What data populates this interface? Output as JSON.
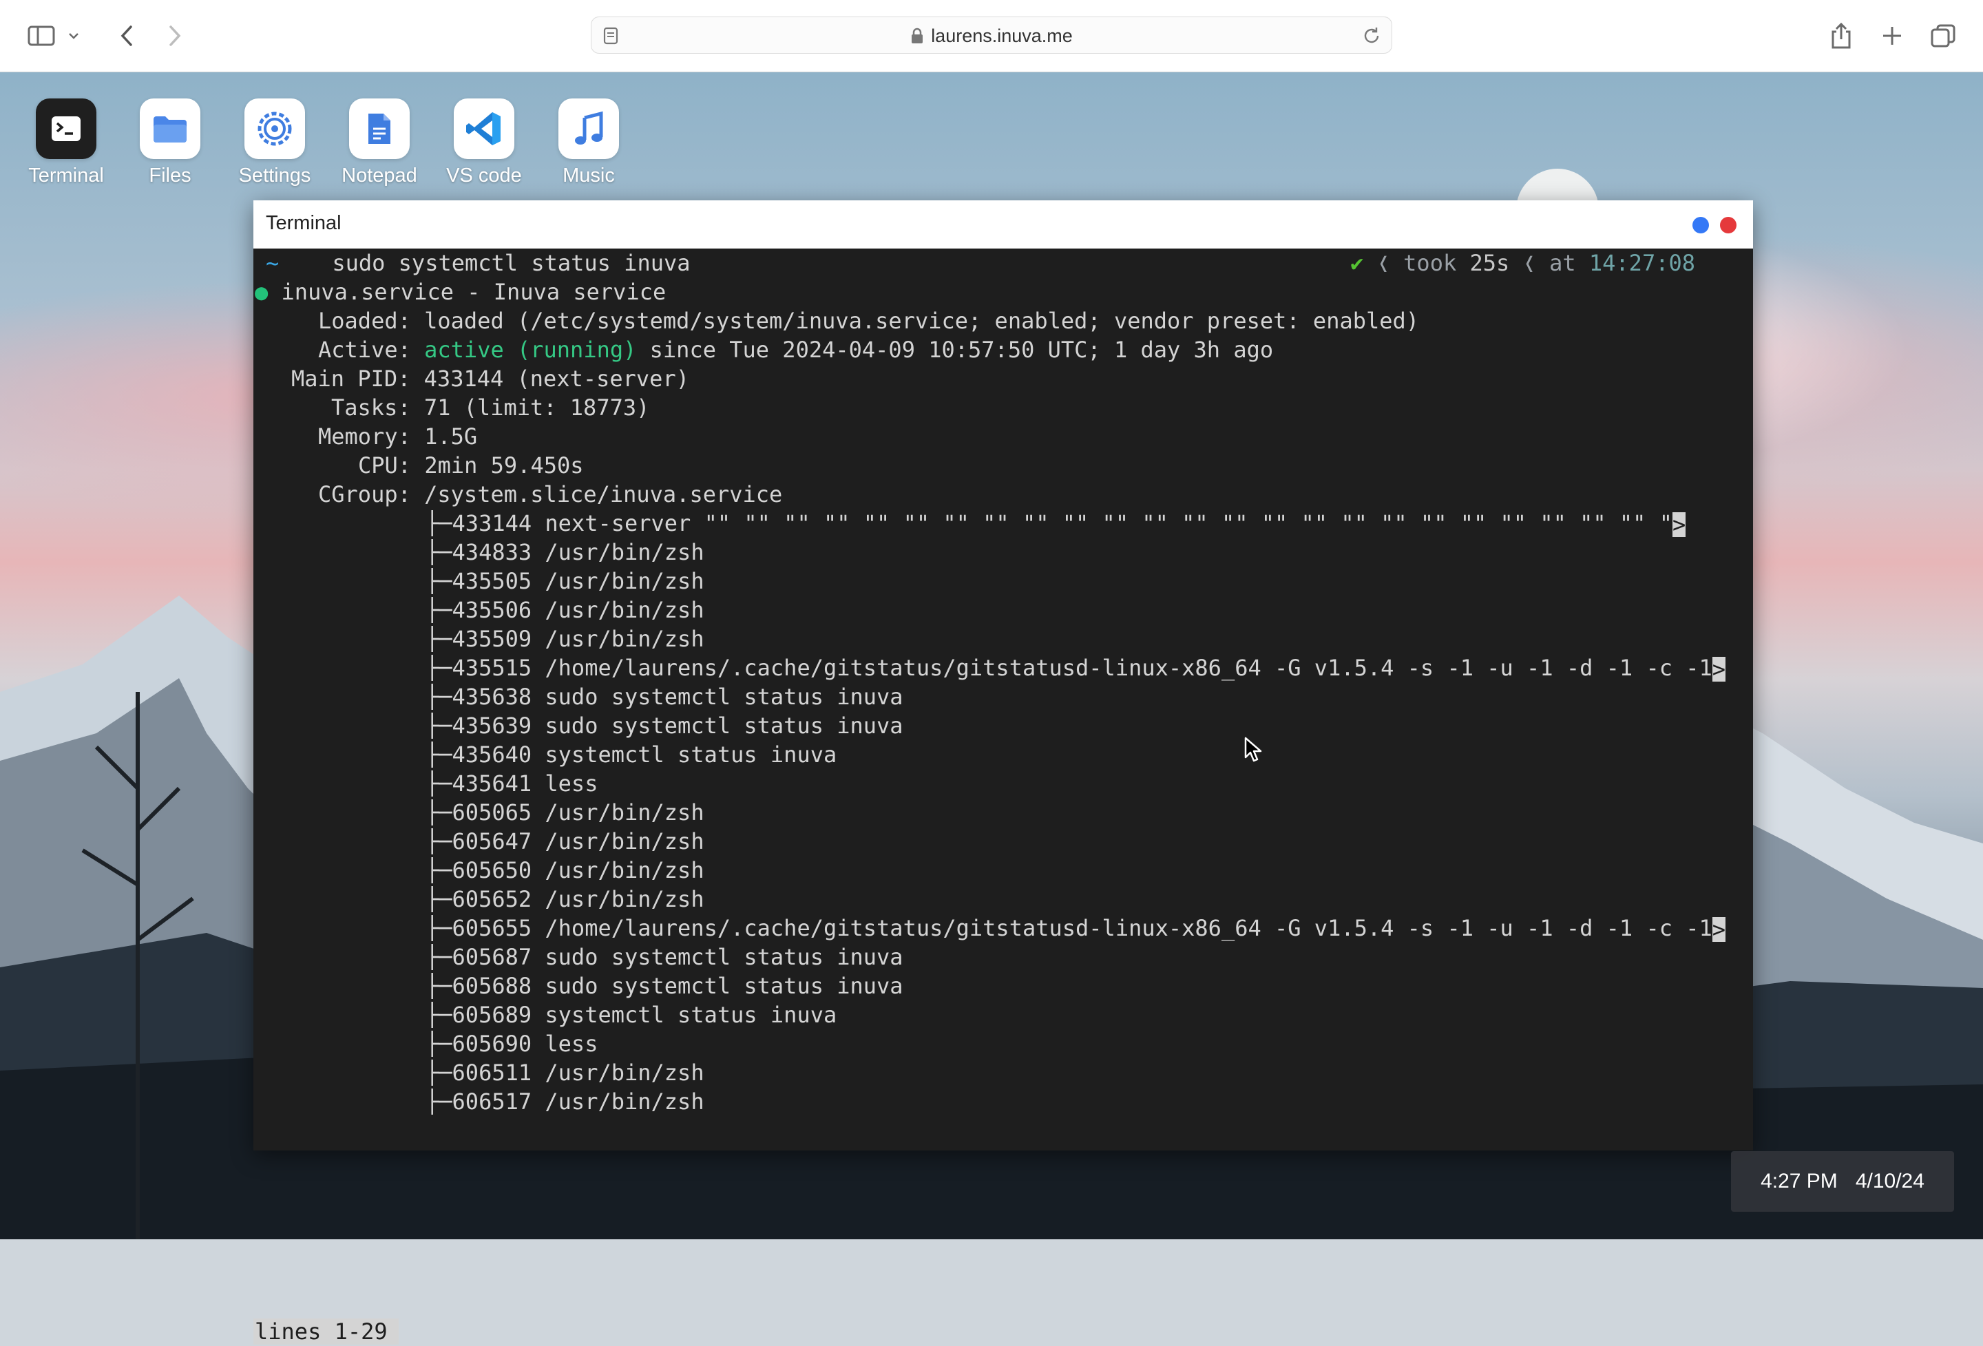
{
  "browser": {
    "url": "laurens.inuva.me"
  },
  "dock": [
    {
      "label": "Terminal",
      "icon": "terminal-icon"
    },
    {
      "label": "Files",
      "icon": "folder-icon"
    },
    {
      "label": "Settings",
      "icon": "gear-icon"
    },
    {
      "label": "Notepad",
      "icon": "document-icon"
    },
    {
      "label": "VS code",
      "icon": "vscode-icon"
    },
    {
      "label": "Music",
      "icon": "music-note-icon"
    }
  ],
  "terminal": {
    "title": "Terminal",
    "prompt": {
      "tilde": "~",
      "command": "sudo systemctl status inuva",
      "check": "✔",
      "took_label": "took",
      "took_value": "25s",
      "at_label": "at",
      "time": "14:27:08"
    },
    "service_header": {
      "dot": "●",
      "text": "inuva.service - Inuva service"
    },
    "status": {
      "loaded_label": "Loaded:",
      "loaded_value": "loaded (/etc/systemd/system/inuva.service; enabled; vendor preset: enabled)",
      "active_label": "Active:",
      "active_state": "active (running)",
      "active_since": "since Tue 2024-04-09 10:57:50 UTC; 1 day 3h ago",
      "mainpid_label": "Main PID:",
      "mainpid_value": "433144 (next-server)",
      "tasks_label": "Tasks:",
      "tasks_value": "71 (limit: 18773)",
      "memory_label": "Memory:",
      "memory_value": "1.5G",
      "cpu_label": "CPU:",
      "cpu_value": "2min 59.450s",
      "cgroup_label": "CGroup:",
      "cgroup_value": "/system.slice/inuva.service"
    },
    "processes": [
      {
        "tree": "├─",
        "pid": "433144",
        "cmd": "next-server \"\" \"\" \"\" \"\" \"\" \"\" \"\" \"\" \"\" \"\" \"\" \"\" \"\" \"\" \"\" \"\" \"\" \"\" \"\" \"\" \"\" \"\" \"\" \"\" \"",
        "truncated": true
      },
      {
        "tree": "├─",
        "pid": "434833",
        "cmd": "/usr/bin/zsh",
        "truncated": false
      },
      {
        "tree": "├─",
        "pid": "435505",
        "cmd": "/usr/bin/zsh",
        "truncated": false
      },
      {
        "tree": "├─",
        "pid": "435506",
        "cmd": "/usr/bin/zsh",
        "truncated": false
      },
      {
        "tree": "├─",
        "pid": "435509",
        "cmd": "/usr/bin/zsh",
        "truncated": false
      },
      {
        "tree": "├─",
        "pid": "435515",
        "cmd": "/home/laurens/.cache/gitstatus/gitstatusd-linux-x86_64 -G v1.5.4 -s -1 -u -1 -d -1 -c -1",
        "truncated": true
      },
      {
        "tree": "├─",
        "pid": "435638",
        "cmd": "sudo systemctl status inuva",
        "truncated": false
      },
      {
        "tree": "├─",
        "pid": "435639",
        "cmd": "sudo systemctl status inuva",
        "truncated": false
      },
      {
        "tree": "├─",
        "pid": "435640",
        "cmd": "systemctl status inuva",
        "truncated": false
      },
      {
        "tree": "├─",
        "pid": "435641",
        "cmd": "less",
        "truncated": false
      },
      {
        "tree": "├─",
        "pid": "605065",
        "cmd": "/usr/bin/zsh",
        "truncated": false
      },
      {
        "tree": "├─",
        "pid": "605647",
        "cmd": "/usr/bin/zsh",
        "truncated": false
      },
      {
        "tree": "├─",
        "pid": "605650",
        "cmd": "/usr/bin/zsh",
        "truncated": false
      },
      {
        "tree": "├─",
        "pid": "605652",
        "cmd": "/usr/bin/zsh",
        "truncated": false
      },
      {
        "tree": "├─",
        "pid": "605655",
        "cmd": "/home/laurens/.cache/gitstatus/gitstatusd-linux-x86_64 -G v1.5.4 -s -1 -u -1 -d -1 -c -1",
        "truncated": true
      },
      {
        "tree": "├─",
        "pid": "605687",
        "cmd": "sudo systemctl status inuva",
        "truncated": false
      },
      {
        "tree": "├─",
        "pid": "605688",
        "cmd": "sudo systemctl status inuva",
        "truncated": false
      },
      {
        "tree": "├─",
        "pid": "605689",
        "cmd": "systemctl status inuva",
        "truncated": false
      },
      {
        "tree": "├─",
        "pid": "605690",
        "cmd": "less",
        "truncated": false
      },
      {
        "tree": "├─",
        "pid": "606511",
        "cmd": "/usr/bin/zsh",
        "truncated": false
      },
      {
        "tree": "├─",
        "pid": "606517",
        "cmd": "/usr/bin/zsh",
        "truncated": false
      }
    ],
    "truncation_marker": ">",
    "pager_indicator": "lines 1-29"
  },
  "clock": {
    "time": "4:27 PM",
    "date": "4/10/24"
  },
  "colors": {
    "terminal_bg": "#1e1e1e",
    "terminal_fg": "#d4d4d4",
    "active_green": "#35c985",
    "prompt_blue": "#3aa7e5",
    "close_red": "#e5393b",
    "minimize_blue": "#3478f6"
  }
}
